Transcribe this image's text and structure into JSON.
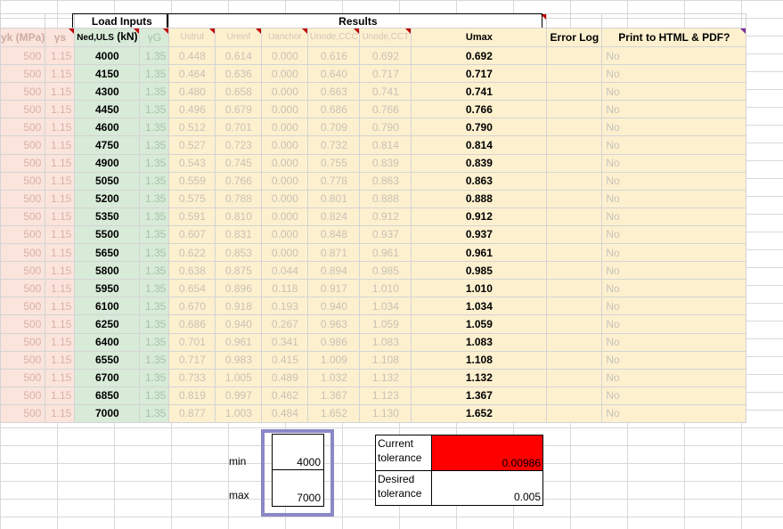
{
  "headers": {
    "load_inputs": "Load Inputs",
    "results": "Results",
    "fyk": "yk (MPa)",
    "gamma_s": "γs",
    "ned_main": "Ned,ULS",
    "ned_unit": " (kN)",
    "gamma_g": "γG",
    "ustrut": "Ustrut",
    "ureinf": "Ureinf",
    "uanchor": "Uanchor",
    "unode_ccc": "Unode,CCC",
    "unode_cct": "Unode,CCT",
    "umax": "Umax",
    "error_log": "Error Log",
    "print": "Print to HTML & PDF?"
  },
  "rows": [
    {
      "fyk": "500",
      "gs": "1.15",
      "ned": "4000",
      "gg": "1.35",
      "ustrut": "0.448",
      "ureinf": "0.614",
      "uanchor": "0.000",
      "uccc": "0.616",
      "ucct": "0.692",
      "umax": "0.692",
      "print": "No"
    },
    {
      "fyk": "500",
      "gs": "1.15",
      "ned": "4150",
      "gg": "1.35",
      "ustrut": "0.464",
      "ureinf": "0.636",
      "uanchor": "0.000",
      "uccc": "0.640",
      "ucct": "0.717",
      "umax": "0.717",
      "print": "No"
    },
    {
      "fyk": "500",
      "gs": "1.15",
      "ned": "4300",
      "gg": "1.35",
      "ustrut": "0.480",
      "ureinf": "0.658",
      "uanchor": "0.000",
      "uccc": "0.663",
      "ucct": "0.741",
      "umax": "0.741",
      "print": "No"
    },
    {
      "fyk": "500",
      "gs": "1.15",
      "ned": "4450",
      "gg": "1.35",
      "ustrut": "0.496",
      "ureinf": "0.679",
      "uanchor": "0.000",
      "uccc": "0.686",
      "ucct": "0.766",
      "umax": "0.766",
      "print": "No"
    },
    {
      "fyk": "500",
      "gs": "1.15",
      "ned": "4600",
      "gg": "1.35",
      "ustrut": "0.512",
      "ureinf": "0.701",
      "uanchor": "0.000",
      "uccc": "0.709",
      "ucct": "0.790",
      "umax": "0.790",
      "print": "No"
    },
    {
      "fyk": "500",
      "gs": "1.15",
      "ned": "4750",
      "gg": "1.35",
      "ustrut": "0.527",
      "ureinf": "0.723",
      "uanchor": "0.000",
      "uccc": "0.732",
      "ucct": "0.814",
      "umax": "0.814",
      "print": "No"
    },
    {
      "fyk": "500",
      "gs": "1.15",
      "ned": "4900",
      "gg": "1.35",
      "ustrut": "0.543",
      "ureinf": "0.745",
      "uanchor": "0.000",
      "uccc": "0.755",
      "ucct": "0.839",
      "umax": "0.839",
      "print": "No"
    },
    {
      "fyk": "500",
      "gs": "1.15",
      "ned": "5050",
      "gg": "1.35",
      "ustrut": "0.559",
      "ureinf": "0.766",
      "uanchor": "0.000",
      "uccc": "0.778",
      "ucct": "0.863",
      "umax": "0.863",
      "print": "No"
    },
    {
      "fyk": "500",
      "gs": "1.15",
      "ned": "5200",
      "gg": "1.35",
      "ustrut": "0.575",
      "ureinf": "0.788",
      "uanchor": "0.000",
      "uccc": "0.801",
      "ucct": "0.888",
      "umax": "0.888",
      "print": "No"
    },
    {
      "fyk": "500",
      "gs": "1.15",
      "ned": "5350",
      "gg": "1.35",
      "ustrut": "0.591",
      "ureinf": "0.810",
      "uanchor": "0.000",
      "uccc": "0.824",
      "ucct": "0.912",
      "umax": "0.912",
      "print": "No"
    },
    {
      "fyk": "500",
      "gs": "1.15",
      "ned": "5500",
      "gg": "1.35",
      "ustrut": "0.607",
      "ureinf": "0.831",
      "uanchor": "0.000",
      "uccc": "0.848",
      "ucct": "0.937",
      "umax": "0.937",
      "print": "No"
    },
    {
      "fyk": "500",
      "gs": "1.15",
      "ned": "5650",
      "gg": "1.35",
      "ustrut": "0.622",
      "ureinf": "0.853",
      "uanchor": "0.000",
      "uccc": "0.871",
      "ucct": "0.961",
      "umax": "0.961",
      "print": "No"
    },
    {
      "fyk": "500",
      "gs": "1.15",
      "ned": "5800",
      "gg": "1.35",
      "ustrut": "0.638",
      "ureinf": "0.875",
      "uanchor": "0.044",
      "uccc": "0.894",
      "ucct": "0.985",
      "umax": "0.985",
      "print": "No"
    },
    {
      "fyk": "500",
      "gs": "1.15",
      "ned": "5950",
      "gg": "1.35",
      "ustrut": "0.654",
      "ureinf": "0.896",
      "uanchor": "0.118",
      "uccc": "0.917",
      "ucct": "1.010",
      "umax": "1.010",
      "print": "No"
    },
    {
      "fyk": "500",
      "gs": "1.15",
      "ned": "6100",
      "gg": "1.35",
      "ustrut": "0.670",
      "ureinf": "0.918",
      "uanchor": "0.193",
      "uccc": "0.940",
      "ucct": "1.034",
      "umax": "1.034",
      "print": "No"
    },
    {
      "fyk": "500",
      "gs": "1.15",
      "ned": "6250",
      "gg": "1.35",
      "ustrut": "0.686",
      "ureinf": "0.940",
      "uanchor": "0.267",
      "uccc": "0.963",
      "ucct": "1.059",
      "umax": "1.059",
      "print": "No"
    },
    {
      "fyk": "500",
      "gs": "1.15",
      "ned": "6400",
      "gg": "1.35",
      "ustrut": "0.701",
      "ureinf": "0.961",
      "uanchor": "0.341",
      "uccc": "0.986",
      "ucct": "1.083",
      "umax": "1.083",
      "print": "No"
    },
    {
      "fyk": "500",
      "gs": "1.15",
      "ned": "6550",
      "gg": "1.35",
      "ustrut": "0.717",
      "ureinf": "0.983",
      "uanchor": "0.415",
      "uccc": "1.009",
      "ucct": "1.108",
      "umax": "1.108",
      "print": "No"
    },
    {
      "fyk": "500",
      "gs": "1.15",
      "ned": "6700",
      "gg": "1.35",
      "ustrut": "0.733",
      "ureinf": "1.005",
      "uanchor": "0.489",
      "uccc": "1.032",
      "ucct": "1.132",
      "umax": "1.132",
      "print": "No"
    },
    {
      "fyk": "500",
      "gs": "1.15",
      "ned": "6850",
      "gg": "1.35",
      "ustrut": "0.819",
      "ureinf": "0.997",
      "uanchor": "0.462",
      "uccc": "1.367",
      "ucct": "1.123",
      "umax": "1.367",
      "print": "No"
    },
    {
      "fyk": "500",
      "gs": "1.15",
      "ned": "7000",
      "gg": "1.35",
      "ustrut": "0.877",
      "ureinf": "1.003",
      "uanchor": "0.484",
      "uccc": "1.652",
      "ucct": "1.130",
      "umax": "1.652",
      "print": "No"
    }
  ],
  "range": {
    "min_label": "min",
    "min_value": "4000",
    "max_label": "max",
    "max_value": "7000"
  },
  "tolerance": {
    "current_line1": "Current",
    "current_line2": "tolerance",
    "current_value": "0.00986",
    "desired_line1": "Desired",
    "desired_line2": "tolerance",
    "desired_value": "0.005"
  },
  "colors": {
    "pink": "#fbe4dc",
    "green": "#d8ead8",
    "cream": "#fdf0cf",
    "alert_red": "#ff0000",
    "highlight": "#8a88c6"
  }
}
